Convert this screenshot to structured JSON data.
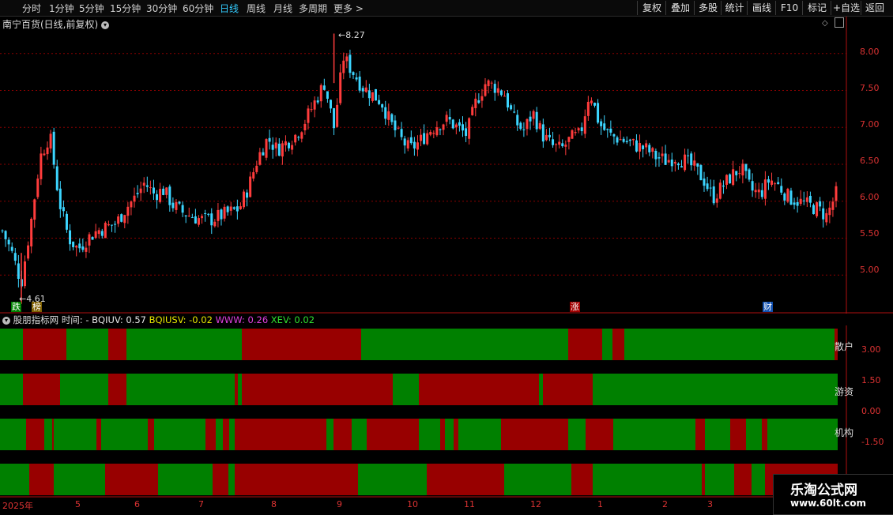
{
  "toolbar": {
    "periods": [
      "分时",
      "1分钟",
      "5分钟",
      "15分钟",
      "30分钟",
      "60分钟",
      "日线",
      "周线",
      "月线",
      "多周期",
      "更多 >"
    ],
    "active_period": "日线",
    "right_buttons": [
      "复权",
      "叠加",
      "多股",
      "统计",
      "画线",
      "F10",
      "标记",
      "+自选",
      "返回"
    ]
  },
  "main_chart": {
    "title": "南宁百货(日线,前复权)",
    "title_icon": "chevron-down-icon",
    "high_label": "8.27",
    "low_label": "4.61",
    "y_ticks": [
      "8.00",
      "7.50",
      "7.00",
      "6.50",
      "6.00",
      "5.50",
      "5.00"
    ],
    "tags": {
      "die": "跌",
      "bang": "榜",
      "zhang": "涨",
      "cai": "财"
    },
    "colors": {
      "up": "#ff3c3c",
      "down": "#3cd5ff",
      "grid": "#8b0000",
      "border": "#b01010"
    }
  },
  "indicator": {
    "name": "股朋指标网",
    "time_label": "时间: -",
    "values": [
      {
        "text": "BQIUV: 0.57",
        "color": "#e8e8e8"
      },
      {
        "text": "BQIUSV: -0.02",
        "color": "#e8e800"
      },
      {
        "text": "WWW: 0.26",
        "color": "#e040e0"
      },
      {
        "text": "XEV: 0.02",
        "color": "#30e030"
      }
    ],
    "y_ticks": [
      "3.00",
      "1.50",
      "0.00",
      "-1.50"
    ],
    "band_labels": [
      "散户",
      "游资",
      "机构",
      ""
    ],
    "colors": {
      "red": "#980000",
      "green": "#008000"
    }
  },
  "x_axis": {
    "labels": [
      "2025年",
      "5",
      "6",
      "7",
      "8",
      "9",
      "10",
      "11",
      "12",
      "1",
      "2",
      "3"
    ]
  },
  "watermark": {
    "line1": "乐淘公式网",
    "line2": "www.60lt.com"
  },
  "chart_data": {
    "type": "candlestick",
    "title": "南宁百货(日线,前复权)",
    "high": 8.27,
    "low": 4.61,
    "ylim": [
      4.5,
      8.5
    ],
    "x_labels": [
      "2025年",
      "5",
      "6",
      "7",
      "8",
      "9",
      "10",
      "11",
      "12",
      "1",
      "2",
      "3"
    ],
    "close_path": [
      5.6,
      5.3,
      4.9,
      5.7,
      6.6,
      6.9,
      6.0,
      5.5,
      5.35,
      5.5,
      5.6,
      5.65,
      5.7,
      5.9,
      6.05,
      6.25,
      6.1,
      6.15,
      5.95,
      5.85,
      5.8,
      5.75,
      5.75,
      5.8,
      5.85,
      5.9,
      6.2,
      6.6,
      6.85,
      6.7,
      6.8,
      6.9,
      7.1,
      7.35,
      7.6,
      7.0,
      7.95,
      7.75,
      7.55,
      7.45,
      7.35,
      7.05,
      6.85,
      6.7,
      6.8,
      6.95,
      7.05,
      7.1,
      7.0,
      6.9,
      7.35,
      7.6,
      7.55,
      7.45,
      7.1,
      6.95,
      7.2,
      6.9,
      6.75,
      6.7,
      6.85,
      6.9,
      7.5,
      7.05,
      6.9,
      6.85,
      6.8,
      6.75,
      6.7,
      6.6,
      6.55,
      6.6,
      6.55,
      6.45,
      6.3,
      6.05,
      6.2,
      6.35,
      6.45,
      6.15,
      6.1,
      6.3,
      6.2,
      6.05,
      6.0,
      5.95,
      5.9,
      5.8,
      6.1
    ],
    "indicator_bands": [
      {
        "name": "散户",
        "segments": [
          [
            "g",
            0,
            29
          ],
          [
            "r",
            29,
            84
          ],
          [
            "g",
            84,
            137
          ],
          [
            "r",
            137,
            160
          ],
          [
            "g",
            160,
            306
          ],
          [
            "r",
            306,
            457
          ],
          [
            "g",
            457,
            719
          ],
          [
            "r",
            719,
            762
          ],
          [
            "g",
            762,
            775
          ],
          [
            "r",
            775,
            790
          ],
          [
            "g",
            790,
            1056
          ],
          [
            "r",
            1056,
            1060
          ]
        ]
      },
      {
        "name": "游资",
        "segments": [
          [
            "g",
            0,
            29
          ],
          [
            "r",
            29,
            76
          ],
          [
            "g",
            76,
            137
          ],
          [
            "r",
            137,
            160
          ],
          [
            "g",
            160,
            297
          ],
          [
            "r",
            297,
            301
          ],
          [
            "g",
            301,
            306
          ],
          [
            "r",
            306,
            497
          ],
          [
            "g",
            497,
            530
          ],
          [
            "r",
            530,
            682
          ],
          [
            "g",
            682,
            687
          ],
          [
            "r",
            687,
            750
          ],
          [
            "g",
            750,
            1060
          ]
        ]
      },
      {
        "name": "机构",
        "segments": [
          [
            "g",
            0,
            33
          ],
          [
            "r",
            33,
            56
          ],
          [
            "g",
            56,
            66
          ],
          [
            "r",
            66,
            68
          ],
          [
            "g",
            68,
            122
          ],
          [
            "r",
            122,
            128
          ],
          [
            "g",
            128,
            187
          ],
          [
            "r",
            187,
            195
          ],
          [
            "g",
            195,
            260
          ],
          [
            "r",
            260,
            273
          ],
          [
            "g",
            273,
            282
          ],
          [
            "r",
            282,
            290
          ],
          [
            "g",
            290,
            297
          ],
          [
            "r",
            297,
            413
          ],
          [
            "g",
            413,
            422
          ],
          [
            "r",
            422,
            445
          ],
          [
            "g",
            445,
            464
          ],
          [
            "r",
            464,
            530
          ],
          [
            "g",
            530,
            557
          ],
          [
            "r",
            557,
            563
          ],
          [
            "g",
            563,
            574
          ],
          [
            "r",
            574,
            580
          ],
          [
            "g",
            580,
            634
          ],
          [
            "r",
            634,
            719
          ],
          [
            "g",
            719,
            741
          ],
          [
            "r",
            741,
            776
          ],
          [
            "g",
            776,
            880
          ],
          [
            "r",
            880,
            892
          ],
          [
            "g",
            892,
            924
          ],
          [
            "r",
            924,
            944
          ],
          [
            "g",
            944,
            964
          ],
          [
            "r",
            964,
            971
          ],
          [
            "g",
            971,
            1060
          ]
        ]
      },
      {
        "name": "",
        "segments": [
          [
            "g",
            0,
            37
          ],
          [
            "r",
            37,
            68
          ],
          [
            "g",
            68,
            133
          ],
          [
            "r",
            133,
            200
          ],
          [
            "g",
            200,
            269
          ],
          [
            "r",
            269,
            289
          ],
          [
            "g",
            289,
            297
          ],
          [
            "r",
            297,
            453
          ],
          [
            "g",
            453,
            540
          ],
          [
            "r",
            540,
            638
          ],
          [
            "g",
            638,
            723
          ],
          [
            "r",
            723,
            750
          ],
          [
            "g",
            750,
            888
          ],
          [
            "r",
            888,
            892
          ],
          [
            "g",
            892,
            929
          ],
          [
            "r",
            929,
            951
          ],
          [
            "g",
            951,
            968
          ],
          [
            "r",
            968,
            1060
          ]
        ]
      }
    ]
  }
}
